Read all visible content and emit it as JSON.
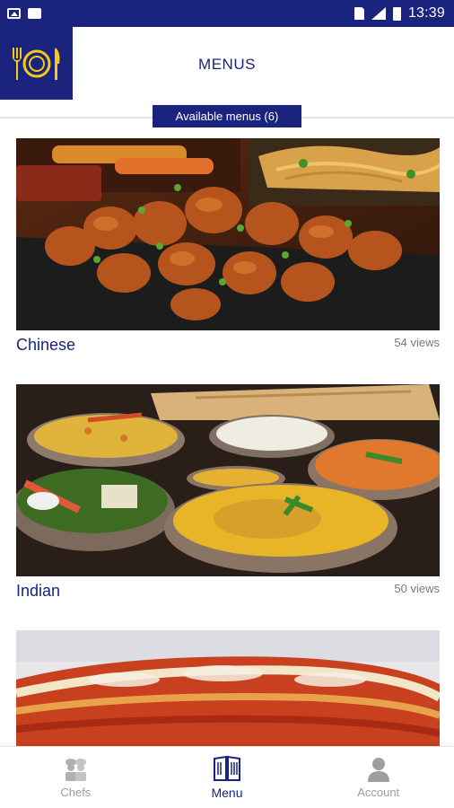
{
  "status_bar": {
    "time": "13:39",
    "icons": [
      "image-icon",
      "message-icon",
      "sim-icon",
      "signal-icon",
      "battery-icon"
    ]
  },
  "header": {
    "title": "MENUS",
    "logo_icon": "fork-plate-knife-icon"
  },
  "available_menus_label": "Available menus (6)",
  "menus": [
    {
      "name": "Chinese",
      "views": "54 views"
    },
    {
      "name": "Indian",
      "views": "50 views"
    },
    {
      "name": "",
      "views": ""
    }
  ],
  "bottom_nav": [
    {
      "label": "Chefs",
      "icon": "chef-icon",
      "active": false
    },
    {
      "label": "Menu",
      "icon": "menu-book-icon",
      "active": true
    },
    {
      "label": "Account",
      "icon": "person-icon",
      "active": false
    }
  ],
  "colors": {
    "primary": "#1a237e",
    "inactive_nav": "#9e9e9e",
    "views_text": "#777777"
  }
}
